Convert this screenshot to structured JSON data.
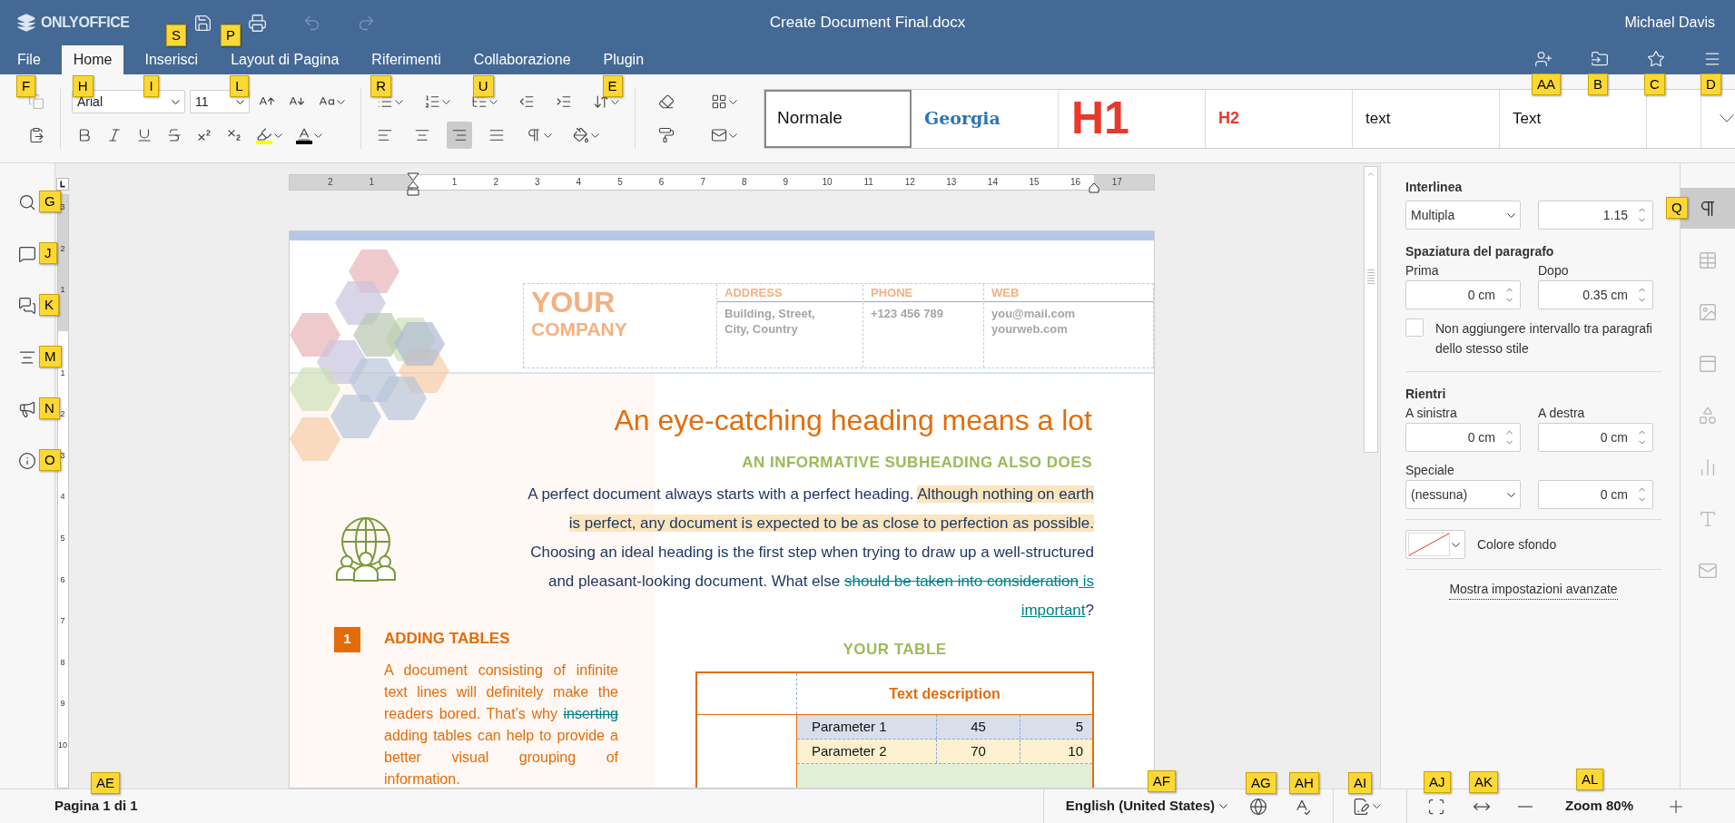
{
  "app": {
    "logo": "ONLYOFFICE",
    "title": "Create Document Final.docx",
    "user": "Michael Davis"
  },
  "quick_actions": [
    {
      "kind": "save",
      "keytip": "S",
      "disabled": false
    },
    {
      "kind": "print",
      "keytip": "P",
      "disabled": false
    },
    {
      "kind": "undo",
      "disabled": true
    },
    {
      "kind": "redo",
      "disabled": true
    }
  ],
  "tabs": [
    {
      "label": "File",
      "keytip": "F",
      "selected": false
    },
    {
      "label": "Home",
      "keytip": "H",
      "selected": true
    },
    {
      "label": "Inserisci",
      "keytip": "I",
      "selected": false
    },
    {
      "label": "Layout di Pagina",
      "keytip": "L",
      "selected": false
    },
    {
      "label": "Riferimenti",
      "keytip": "R",
      "selected": false
    },
    {
      "label": "Collaborazione",
      "keytip": "U",
      "selected": false
    },
    {
      "label": "Plugin",
      "keytip": "E",
      "selected": false
    }
  ],
  "header_actions": [
    {
      "kind": "add-user",
      "keytip": "AA"
    },
    {
      "kind": "open-location",
      "keytip": "B"
    },
    {
      "kind": "favorite",
      "keytip": "C"
    },
    {
      "kind": "menu",
      "keytip": "D"
    }
  ],
  "toolbar_groups": [
    {
      "rows": [
        [
          {
            "kind": "copy",
            "dropdown": false,
            "selected": false,
            "disabled": true
          }
        ],
        [
          {
            "kind": "paste",
            "dropdown": false,
            "selected": false,
            "disabled": false
          }
        ]
      ]
    },
    {
      "rows": [
        [
          {
            "kind": "font-select",
            "value": "Arial"
          },
          {
            "kind": "size-select",
            "value": "11"
          },
          {
            "kind": "grow-font",
            "dropdown": false,
            "selected": false,
            "disabled": false
          },
          {
            "kind": "shrink-font",
            "dropdown": false,
            "selected": false,
            "disabled": false
          },
          {
            "kind": "change-case",
            "dropdown": true,
            "selected": false,
            "disabled": false
          }
        ],
        [
          {
            "kind": "bold",
            "dropdown": false,
            "selected": false,
            "disabled": false
          },
          {
            "kind": "italic",
            "dropdown": false,
            "selected": false,
            "disabled": false
          },
          {
            "kind": "underline",
            "dropdown": false,
            "selected": false,
            "disabled": false
          },
          {
            "kind": "strikethrough",
            "dropdown": false,
            "selected": false,
            "disabled": false
          },
          {
            "kind": "superscript",
            "dropdown": false,
            "selected": false,
            "disabled": false
          },
          {
            "kind": "subscript",
            "dropdown": false,
            "selected": false,
            "disabled": false
          },
          {
            "kind": "highlight",
            "dropdown": true,
            "selected": false,
            "disabled": false,
            "color": "#ffff00"
          },
          {
            "kind": "font-color",
            "dropdown": true,
            "selected": false,
            "disabled": false,
            "color": "#000000"
          }
        ]
      ]
    },
    {
      "rows": [
        [
          {
            "kind": "bullets",
            "dropdown": true,
            "selected": false,
            "disabled": false
          },
          {
            "kind": "numbering",
            "dropdown": true,
            "selected": false,
            "disabled": false
          },
          {
            "kind": "multilevel",
            "dropdown": true,
            "selected": false,
            "disabled": false
          },
          {
            "kind": "outdent",
            "dropdown": false,
            "selected": false,
            "disabled": false
          },
          {
            "kind": "indent",
            "dropdown": false,
            "selected": false,
            "disabled": false
          },
          {
            "kind": "line-spacing",
            "dropdown": true,
            "selected": false,
            "disabled": false
          }
        ],
        [
          {
            "kind": "align-left",
            "dropdown": false,
            "selected": false,
            "disabled": false
          },
          {
            "kind": "align-center",
            "dropdown": false,
            "selected": false,
            "disabled": false
          },
          {
            "kind": "align-right",
            "dropdown": false,
            "selected": true,
            "disabled": false
          },
          {
            "kind": "justify",
            "dropdown": false,
            "selected": false,
            "disabled": false
          },
          {
            "kind": "pilcrow",
            "dropdown": true,
            "selected": false,
            "disabled": false
          },
          {
            "kind": "shading",
            "dropdown": true,
            "selected": false,
            "disabled": false
          }
        ]
      ]
    },
    {
      "rows": [
        [
          {
            "kind": "clear-style",
            "dropdown": false,
            "selected": false,
            "disabled": false
          },
          {
            "kind": "color-scheme",
            "dropdown": true,
            "selected": false,
            "disabled": false
          }
        ],
        [
          {
            "kind": "copy-style",
            "dropdown": false,
            "selected": false,
            "disabled": false
          },
          {
            "kind": "mail-merge",
            "dropdown": true,
            "selected": false,
            "disabled": false
          }
        ]
      ]
    }
  ],
  "styles": [
    {
      "kind": "normal",
      "label": "Normale",
      "selected": true
    },
    {
      "kind": "serif",
      "label": "Georgia",
      "selected": false
    },
    {
      "kind": "h1",
      "label": "H1",
      "selected": false
    },
    {
      "kind": "h2",
      "label": "H2",
      "selected": false
    },
    {
      "kind": "plain",
      "label": "text",
      "selected": false
    },
    {
      "kind": "plain",
      "label": "Text",
      "selected": false
    },
    {
      "kind": "empty",
      "selected": false
    }
  ],
  "left_sidebar": [
    {
      "kind": "search",
      "keytip": "G"
    },
    {
      "kind": "comments",
      "keytip": "J"
    },
    {
      "kind": "chat",
      "keytip": "K"
    },
    {
      "kind": "navigation",
      "keytip": "M"
    },
    {
      "kind": "feedback",
      "keytip": "N"
    },
    {
      "kind": "about",
      "keytip": "O"
    }
  ],
  "ruler": {
    "h_before": [
      "2",
      "1"
    ],
    "h_after": [
      "1",
      "2",
      "3",
      "4",
      "5",
      "6",
      "7",
      "8",
      "9",
      "10",
      "11",
      "12",
      "13",
      "14",
      "15",
      "16",
      "17"
    ],
    "v_before": [
      "3",
      "2",
      "1"
    ],
    "v_after": [
      "1",
      "2",
      "3",
      "4",
      "5",
      "6",
      "7",
      "8",
      "9",
      "10"
    ]
  },
  "document": {
    "company": {
      "line1": "YOUR",
      "line2": "COMPANY"
    },
    "contacts": [
      {
        "label": "ADDRESS",
        "lines": [
          "Building, Street,",
          "City, Country"
        ]
      },
      {
        "label": "PHONE",
        "lines": [
          "+123 456 789"
        ]
      },
      {
        "label": "WEB",
        "lines": [
          "you@mail.com",
          "yourweb.com"
        ]
      }
    ],
    "heading": "An eye-catching heading means a lot",
    "subheading": "AN INFORMATIVE SUBHEADING ALSO DOES",
    "intro": [
      {
        "kind": "plain",
        "text": "A perfect document always starts with a perfect heading. "
      },
      {
        "kind": "highlight",
        "text": "Although nothing on earth is perfect, any document is expected to be as close to perfection as possible."
      },
      {
        "kind": "plain",
        "text": " Choosing an ideal heading is the first step when trying to draw up a well-structured and pleasant-looking document. What else "
      },
      {
        "kind": "deleted",
        "text": "should be taken into consideration"
      },
      {
        "kind": "inserted",
        "text": " is important"
      },
      {
        "kind": "plain",
        "text": "?"
      }
    ],
    "section": {
      "number": "1",
      "title": "ADDING TABLES",
      "body": [
        {
          "kind": "plain",
          "text": "A document consisting of infinite text lines will definitely make the readers bored. That’s why "
        },
        {
          "kind": "deleted",
          "text": "inserting"
        },
        {
          "kind": "plain",
          "text": " adding tables can help to provide a better visual grouping of information."
        }
      ]
    },
    "table": {
      "title": "YOUR TABLE",
      "header": "Text description",
      "rows": [
        {
          "cells": [
            "Parameter 1",
            "45",
            "5"
          ],
          "color": "#d9dfea"
        },
        {
          "cells": [
            "Parameter 2",
            "70",
            "10"
          ],
          "color": "#fdf0cf"
        },
        {
          "cells": [],
          "color": "#e2efd9"
        }
      ]
    }
  },
  "paragraph_panel": {
    "line_spacing_label": "Interlinea",
    "line_spacing_mode": "Multipla",
    "line_spacing_value": "1.15",
    "spacing_label": "Spaziatura del paragrafo",
    "before_label": "Prima",
    "before": "0 cm",
    "after_label": "Dopo",
    "after": "0.35 cm",
    "no_space": {
      "label": "Non aggiungere intervallo tra paragrafi dello stesso stile",
      "checked": false
    },
    "indents_label": "Rientri",
    "left_label": "A sinistra",
    "left": "0 cm",
    "right_label": "A destra",
    "right": "0 cm",
    "special_label": "Speciale",
    "special": "(nessuna)",
    "special_value": "0 cm",
    "background_label": "Colore sfondo",
    "advanced_link": "Mostra impostazioni avanzate"
  },
  "right_bar": [
    {
      "kind": "paragraph",
      "keytip": "Q",
      "selected": true,
      "disabled": false
    },
    {
      "kind": "table",
      "selected": false,
      "disabled": true
    },
    {
      "kind": "image",
      "selected": false,
      "disabled": true
    },
    {
      "kind": "header-footer",
      "selected": false,
      "disabled": true
    },
    {
      "kind": "shape",
      "selected": false,
      "disabled": true
    },
    {
      "kind": "chart",
      "selected": false,
      "disabled": true
    },
    {
      "kind": "text-art",
      "selected": false,
      "disabled": true
    },
    {
      "kind": "mail-merge",
      "selected": false,
      "disabled": true
    }
  ],
  "status_bar": {
    "page": "Pagina 1 di 1",
    "page_keytip": "AE",
    "language": "English (United States)",
    "language_keytip": "AF",
    "tools": [
      {
        "kind": "globe",
        "keytip": "AG"
      },
      {
        "kind": "spellcheck",
        "keytip": "AH"
      },
      {
        "kind": "track-changes",
        "keytip": "AI",
        "dropdown": true
      }
    ],
    "fit": [
      {
        "kind": "fit-page",
        "keytip": "AJ"
      },
      {
        "kind": "fit-width",
        "keytip": "AK"
      }
    ],
    "zoom": "Zoom 80%",
    "zoom_keytip": "AL"
  }
}
